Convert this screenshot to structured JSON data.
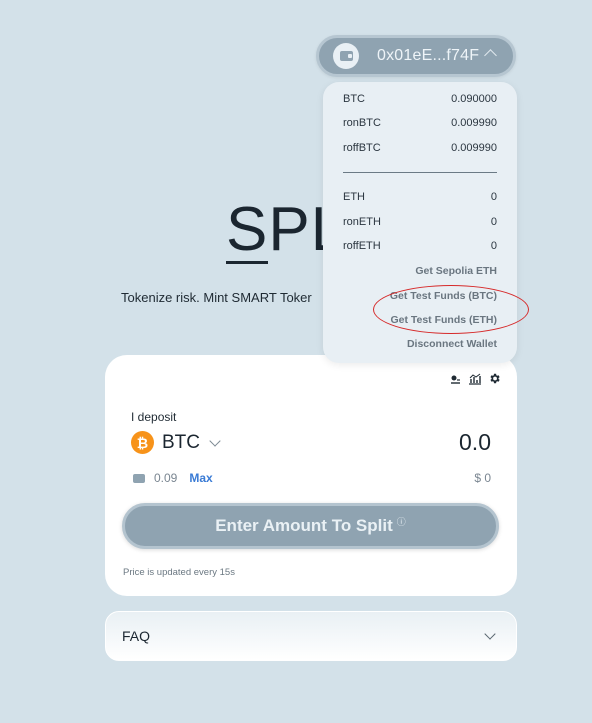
{
  "hero": {
    "title_first": "S",
    "title_rest": "PL",
    "tagline": "Tokenize risk. Mint SMART Toker"
  },
  "wallet": {
    "address": "0x01eE...f74F"
  },
  "dropdown": {
    "balances_btc": [
      {
        "token": "BTC",
        "amount": "0.090000"
      },
      {
        "token": "ronBTC",
        "amount": "0.009990"
      },
      {
        "token": "roffBTC",
        "amount": "0.009990"
      }
    ],
    "balances_eth": [
      {
        "token": "ETH",
        "amount": "0"
      },
      {
        "token": "ronETH",
        "amount": "0"
      },
      {
        "token": "roffETH",
        "amount": "0"
      }
    ],
    "links": {
      "sepolia": "Get Sepolia ETH",
      "test_btc": "Get Test Funds (BTC)",
      "test_eth": "Get Test Funds (ETH)",
      "disconnect": "Disconnect Wallet"
    },
    "highlight_color": "#d62a2a"
  },
  "card": {
    "deposit_label": "I deposit",
    "token_symbol": "BTC",
    "token_icon_glyph": "₿",
    "amount": "0.0",
    "balance": "0.09",
    "max_label": "Max",
    "usd_value": "$ 0",
    "button_label": "Enter Amount To Split",
    "info_glyph": "ⓘ",
    "price_note": "Price is updated every 15s",
    "tools": [
      "slippage-icon",
      "chart-icon",
      "gear-icon"
    ]
  },
  "faq": {
    "label": "FAQ"
  },
  "colors": {
    "background": "#d3e1e9",
    "accent_blue": "#3a7bd5",
    "btc_orange": "#f7931a",
    "button_gray": "#8fa3b1"
  }
}
